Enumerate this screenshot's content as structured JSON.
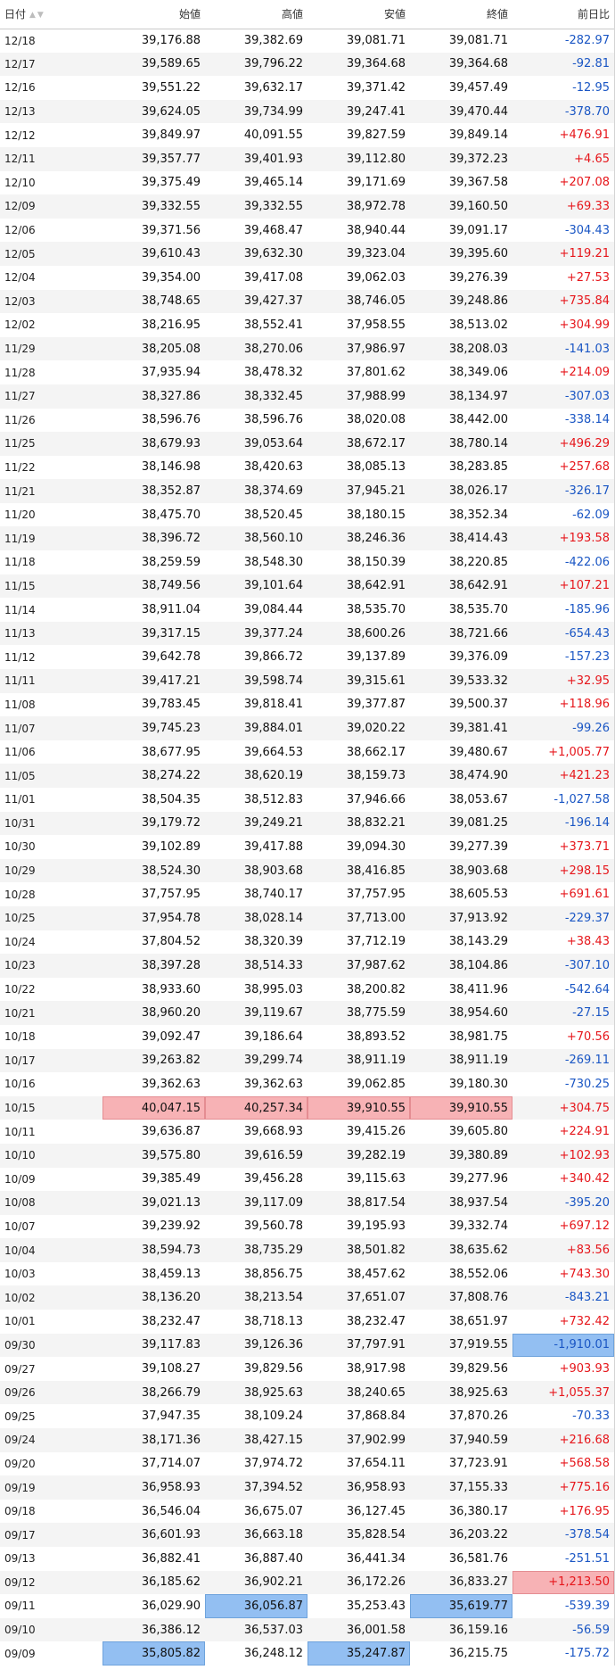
{
  "headers": [
    "日付",
    "始値",
    "高値",
    "安値",
    "終値",
    "前日比"
  ],
  "sort_icon": "▲▼",
  "colors": {
    "positive": "#e6161b",
    "negative": "#1a56c4",
    "highlight_high": "#f7b2b5",
    "highlight_low": "#93bff2"
  },
  "rows": [
    {
      "date": "12/18",
      "open": "39,176.88",
      "high": "39,382.69",
      "low": "39,081.71",
      "close": "39,081.71",
      "change": "-282.97"
    },
    {
      "date": "12/17",
      "open": "39,589.65",
      "high": "39,796.22",
      "low": "39,364.68",
      "close": "39,364.68",
      "change": "-92.81"
    },
    {
      "date": "12/16",
      "open": "39,551.22",
      "high": "39,632.17",
      "low": "39,371.42",
      "close": "39,457.49",
      "change": "-12.95"
    },
    {
      "date": "12/13",
      "open": "39,624.05",
      "high": "39,734.99",
      "low": "39,247.41",
      "close": "39,470.44",
      "change": "-378.70"
    },
    {
      "date": "12/12",
      "open": "39,849.97",
      "high": "40,091.55",
      "low": "39,827.59",
      "close": "39,849.14",
      "change": "+476.91"
    },
    {
      "date": "12/11",
      "open": "39,357.77",
      "high": "39,401.93",
      "low": "39,112.80",
      "close": "39,372.23",
      "change": "+4.65"
    },
    {
      "date": "12/10",
      "open": "39,375.49",
      "high": "39,465.14",
      "low": "39,171.69",
      "close": "39,367.58",
      "change": "+207.08"
    },
    {
      "date": "12/09",
      "open": "39,332.55",
      "high": "39,332.55",
      "low": "38,972.78",
      "close": "39,160.50",
      "change": "+69.33"
    },
    {
      "date": "12/06",
      "open": "39,371.56",
      "high": "39,468.47",
      "low": "38,940.44",
      "close": "39,091.17",
      "change": "-304.43"
    },
    {
      "date": "12/05",
      "open": "39,610.43",
      "high": "39,632.30",
      "low": "39,323.04",
      "close": "39,395.60",
      "change": "+119.21"
    },
    {
      "date": "12/04",
      "open": "39,354.00",
      "high": "39,417.08",
      "low": "39,062.03",
      "close": "39,276.39",
      "change": "+27.53"
    },
    {
      "date": "12/03",
      "open": "38,748.65",
      "high": "39,427.37",
      "low": "38,746.05",
      "close": "39,248.86",
      "change": "+735.84"
    },
    {
      "date": "12/02",
      "open": "38,216.95",
      "high": "38,552.41",
      "low": "37,958.55",
      "close": "38,513.02",
      "change": "+304.99"
    },
    {
      "date": "11/29",
      "open": "38,205.08",
      "high": "38,270.06",
      "low": "37,986.97",
      "close": "38,208.03",
      "change": "-141.03"
    },
    {
      "date": "11/28",
      "open": "37,935.94",
      "high": "38,478.32",
      "low": "37,801.62",
      "close": "38,349.06",
      "change": "+214.09"
    },
    {
      "date": "11/27",
      "open": "38,327.86",
      "high": "38,332.45",
      "low": "37,988.99",
      "close": "38,134.97",
      "change": "-307.03"
    },
    {
      "date": "11/26",
      "open": "38,596.76",
      "high": "38,596.76",
      "low": "38,020.08",
      "close": "38,442.00",
      "change": "-338.14"
    },
    {
      "date": "11/25",
      "open": "38,679.93",
      "high": "39,053.64",
      "low": "38,672.17",
      "close": "38,780.14",
      "change": "+496.29"
    },
    {
      "date": "11/22",
      "open": "38,146.98",
      "high": "38,420.63",
      "low": "38,085.13",
      "close": "38,283.85",
      "change": "+257.68"
    },
    {
      "date": "11/21",
      "open": "38,352.87",
      "high": "38,374.69",
      "low": "37,945.21",
      "close": "38,026.17",
      "change": "-326.17"
    },
    {
      "date": "11/20",
      "open": "38,475.70",
      "high": "38,520.45",
      "low": "38,180.15",
      "close": "38,352.34",
      "change": "-62.09"
    },
    {
      "date": "11/19",
      "open": "38,396.72",
      "high": "38,560.10",
      "low": "38,246.36",
      "close": "38,414.43",
      "change": "+193.58"
    },
    {
      "date": "11/18",
      "open": "38,259.59",
      "high": "38,548.30",
      "low": "38,150.39",
      "close": "38,220.85",
      "change": "-422.06"
    },
    {
      "date": "11/15",
      "open": "38,749.56",
      "high": "39,101.64",
      "low": "38,642.91",
      "close": "38,642.91",
      "change": "+107.21"
    },
    {
      "date": "11/14",
      "open": "38,911.04",
      "high": "39,084.44",
      "low": "38,535.70",
      "close": "38,535.70",
      "change": "-185.96"
    },
    {
      "date": "11/13",
      "open": "39,317.15",
      "high": "39,377.24",
      "low": "38,600.26",
      "close": "38,721.66",
      "change": "-654.43"
    },
    {
      "date": "11/12",
      "open": "39,642.78",
      "high": "39,866.72",
      "low": "39,137.89",
      "close": "39,376.09",
      "change": "-157.23"
    },
    {
      "date": "11/11",
      "open": "39,417.21",
      "high": "39,598.74",
      "low": "39,315.61",
      "close": "39,533.32",
      "change": "+32.95"
    },
    {
      "date": "11/08",
      "open": "39,783.45",
      "high": "39,818.41",
      "low": "39,377.87",
      "close": "39,500.37",
      "change": "+118.96"
    },
    {
      "date": "11/07",
      "open": "39,745.23",
      "high": "39,884.01",
      "low": "39,020.22",
      "close": "39,381.41",
      "change": "-99.26"
    },
    {
      "date": "11/06",
      "open": "38,677.95",
      "high": "39,664.53",
      "low": "38,662.17",
      "close": "39,480.67",
      "change": "+1,005.77"
    },
    {
      "date": "11/05",
      "open": "38,274.22",
      "high": "38,620.19",
      "low": "38,159.73",
      "close": "38,474.90",
      "change": "+421.23"
    },
    {
      "date": "11/01",
      "open": "38,504.35",
      "high": "38,512.83",
      "low": "37,946.66",
      "close": "38,053.67",
      "change": "-1,027.58"
    },
    {
      "date": "10/31",
      "open": "39,179.72",
      "high": "39,249.21",
      "low": "38,832.21",
      "close": "39,081.25",
      "change": "-196.14"
    },
    {
      "date": "10/30",
      "open": "39,102.89",
      "high": "39,417.88",
      "low": "39,094.30",
      "close": "39,277.39",
      "change": "+373.71"
    },
    {
      "date": "10/29",
      "open": "38,524.30",
      "high": "38,903.68",
      "low": "38,416.85",
      "close": "38,903.68",
      "change": "+298.15"
    },
    {
      "date": "10/28",
      "open": "37,757.95",
      "high": "38,740.17",
      "low": "37,757.95",
      "close": "38,605.53",
      "change": "+691.61"
    },
    {
      "date": "10/25",
      "open": "37,954.78",
      "high": "38,028.14",
      "low": "37,713.00",
      "close": "37,913.92",
      "change": "-229.37"
    },
    {
      "date": "10/24",
      "open": "37,804.52",
      "high": "38,320.39",
      "low": "37,712.19",
      "close": "38,143.29",
      "change": "+38.43"
    },
    {
      "date": "10/23",
      "open": "38,397.28",
      "high": "38,514.33",
      "low": "37,987.62",
      "close": "38,104.86",
      "change": "-307.10"
    },
    {
      "date": "10/22",
      "open": "38,933.60",
      "high": "38,995.03",
      "low": "38,200.82",
      "close": "38,411.96",
      "change": "-542.64"
    },
    {
      "date": "10/21",
      "open": "38,960.20",
      "high": "39,119.67",
      "low": "38,775.59",
      "close": "38,954.60",
      "change": "-27.15"
    },
    {
      "date": "10/18",
      "open": "39,092.47",
      "high": "39,186.64",
      "low": "38,893.52",
      "close": "38,981.75",
      "change": "+70.56"
    },
    {
      "date": "10/17",
      "open": "39,263.82",
      "high": "39,299.74",
      "low": "38,911.19",
      "close": "38,911.19",
      "change": "-269.11"
    },
    {
      "date": "10/16",
      "open": "39,362.63",
      "high": "39,362.63",
      "low": "39,062.85",
      "close": "39,180.30",
      "change": "-730.25"
    },
    {
      "date": "10/15",
      "open": "40,047.15",
      "high": "40,257.34",
      "low": "39,910.55",
      "close": "39,910.55",
      "change": "+304.75",
      "hl": {
        "open": "red",
        "high": "red",
        "low": "red",
        "close": "red"
      }
    },
    {
      "date": "10/11",
      "open": "39,636.87",
      "high": "39,668.93",
      "low": "39,415.26",
      "close": "39,605.80",
      "change": "+224.91"
    },
    {
      "date": "10/10",
      "open": "39,575.80",
      "high": "39,616.59",
      "low": "39,282.19",
      "close": "39,380.89",
      "change": "+102.93"
    },
    {
      "date": "10/09",
      "open": "39,385.49",
      "high": "39,456.28",
      "low": "39,115.63",
      "close": "39,277.96",
      "change": "+340.42"
    },
    {
      "date": "10/08",
      "open": "39,021.13",
      "high": "39,117.09",
      "low": "38,817.54",
      "close": "38,937.54",
      "change": "-395.20"
    },
    {
      "date": "10/07",
      "open": "39,239.92",
      "high": "39,560.78",
      "low": "39,195.93",
      "close": "39,332.74",
      "change": "+697.12"
    },
    {
      "date": "10/04",
      "open": "38,594.73",
      "high": "38,735.29",
      "low": "38,501.82",
      "close": "38,635.62",
      "change": "+83.56"
    },
    {
      "date": "10/03",
      "open": "38,459.13",
      "high": "38,856.75",
      "low": "38,457.62",
      "close": "38,552.06",
      "change": "+743.30"
    },
    {
      "date": "10/02",
      "open": "38,136.20",
      "high": "38,213.54",
      "low": "37,651.07",
      "close": "37,808.76",
      "change": "-843.21"
    },
    {
      "date": "10/01",
      "open": "38,232.47",
      "high": "38,718.13",
      "low": "38,232.47",
      "close": "38,651.97",
      "change": "+732.42"
    },
    {
      "date": "09/30",
      "open": "39,117.83",
      "high": "39,126.36",
      "low": "37,797.91",
      "close": "37,919.55",
      "change": "-1,910.01",
      "hl": {
        "change": "blue"
      }
    },
    {
      "date": "09/27",
      "open": "39,108.27",
      "high": "39,829.56",
      "low": "38,917.98",
      "close": "39,829.56",
      "change": "+903.93"
    },
    {
      "date": "09/26",
      "open": "38,266.79",
      "high": "38,925.63",
      "low": "38,240.65",
      "close": "38,925.63",
      "change": "+1,055.37"
    },
    {
      "date": "09/25",
      "open": "37,947.35",
      "high": "38,109.24",
      "low": "37,868.84",
      "close": "37,870.26",
      "change": "-70.33"
    },
    {
      "date": "09/24",
      "open": "38,171.36",
      "high": "38,427.15",
      "low": "37,902.99",
      "close": "37,940.59",
      "change": "+216.68"
    },
    {
      "date": "09/20",
      "open": "37,714.07",
      "high": "37,974.72",
      "low": "37,654.11",
      "close": "37,723.91",
      "change": "+568.58"
    },
    {
      "date": "09/19",
      "open": "36,958.93",
      "high": "37,394.52",
      "low": "36,958.93",
      "close": "37,155.33",
      "change": "+775.16"
    },
    {
      "date": "09/18",
      "open": "36,546.04",
      "high": "36,675.07",
      "low": "36,127.45",
      "close": "36,380.17",
      "change": "+176.95"
    },
    {
      "date": "09/17",
      "open": "36,601.93",
      "high": "36,663.18",
      "low": "35,828.54",
      "close": "36,203.22",
      "change": "-378.54"
    },
    {
      "date": "09/13",
      "open": "36,882.41",
      "high": "36,887.40",
      "low": "36,441.34",
      "close": "36,581.76",
      "change": "-251.51"
    },
    {
      "date": "09/12",
      "open": "36,185.62",
      "high": "36,902.21",
      "low": "36,172.26",
      "close": "36,833.27",
      "change": "+1,213.50",
      "hl": {
        "change": "red"
      }
    },
    {
      "date": "09/11",
      "open": "36,029.90",
      "high": "36,056.87",
      "low": "35,253.43",
      "close": "35,619.77",
      "change": "-539.39",
      "hl": {
        "high": "blue",
        "close": "blue"
      }
    },
    {
      "date": "09/10",
      "open": "36,386.12",
      "high": "36,537.03",
      "low": "36,001.58",
      "close": "36,159.16",
      "change": "-56.59"
    },
    {
      "date": "09/09",
      "open": "35,805.82",
      "high": "36,248.12",
      "low": "35,247.87",
      "close": "36,215.75",
      "change": "-175.72",
      "hl": {
        "open": "blue",
        "low": "blue"
      }
    }
  ]
}
